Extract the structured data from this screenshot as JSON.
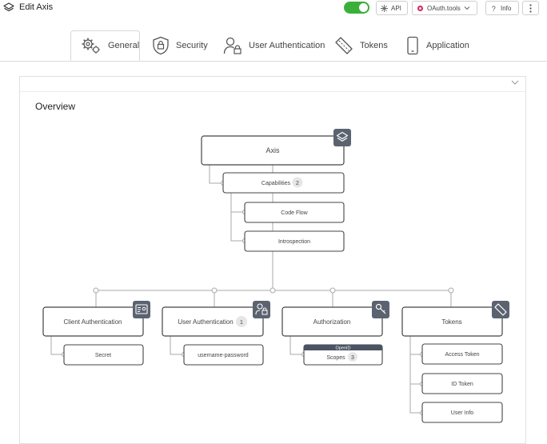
{
  "app": {
    "title": "Edit Axis",
    "icon": "layers-icon"
  },
  "toolbar": {
    "toggle_on": true,
    "api_label": "API",
    "oauth_label": "OAuth.tools",
    "info_label": "Info",
    "more_icon": "kebab-menu-icon",
    "accent": "#3ab03a"
  },
  "tabs": [
    {
      "label": "General",
      "icon": "gears-icon",
      "active": true
    },
    {
      "label": "Security",
      "icon": "shield-icon",
      "active": false
    },
    {
      "label": "User Authentication",
      "icon": "user-lock-icon",
      "active": false
    },
    {
      "label": "Tokens",
      "icon": "ticket-icon",
      "active": false
    },
    {
      "label": "Application",
      "icon": "mobile-icon",
      "active": false
    }
  ],
  "overview": {
    "title": "Overview",
    "root": {
      "label": "Axis",
      "icon": "layers-icon"
    },
    "capabilities": {
      "label": "Capabilities",
      "count": "2",
      "children": [
        "Code Flow",
        "Introspection"
      ]
    },
    "groups": [
      {
        "label": "Client Authentication",
        "icon": "client-card-icon",
        "children": [
          "Secret"
        ]
      },
      {
        "label": "User Authentication",
        "count": "1",
        "icon": "user-lock-icon",
        "children": [
          "username-password"
        ]
      },
      {
        "label": "Authorization",
        "icon": "key-icon",
        "children": [
          {
            "tag": "OpenID",
            "label": "Scopes",
            "count": "3"
          }
        ]
      },
      {
        "label": "Tokens",
        "icon": "ticket-icon",
        "children": [
          "Access Token",
          "ID Token",
          "User Info"
        ]
      }
    ]
  }
}
